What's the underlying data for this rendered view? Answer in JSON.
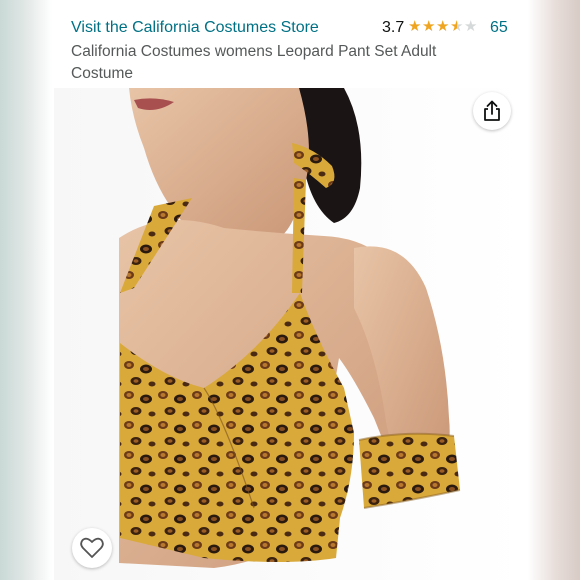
{
  "header": {
    "store_link": "Visit the California Costumes Store",
    "rating": "3.7",
    "rating_value": 3.7,
    "rating_max": 5,
    "review_count": "65",
    "product_title": "California Costumes womens Leopard Pant Set Adult Costume"
  },
  "product_image": {
    "subject": "model wearing leopard print halter crop top and arm band"
  },
  "controls": {
    "share_icon": "share-icon",
    "wishlist_icon": "heart-outline-icon"
  },
  "colors": {
    "link": "#007185",
    "star": "#f0a520",
    "star_empty": "#d5d9d9",
    "title": "#565959"
  }
}
